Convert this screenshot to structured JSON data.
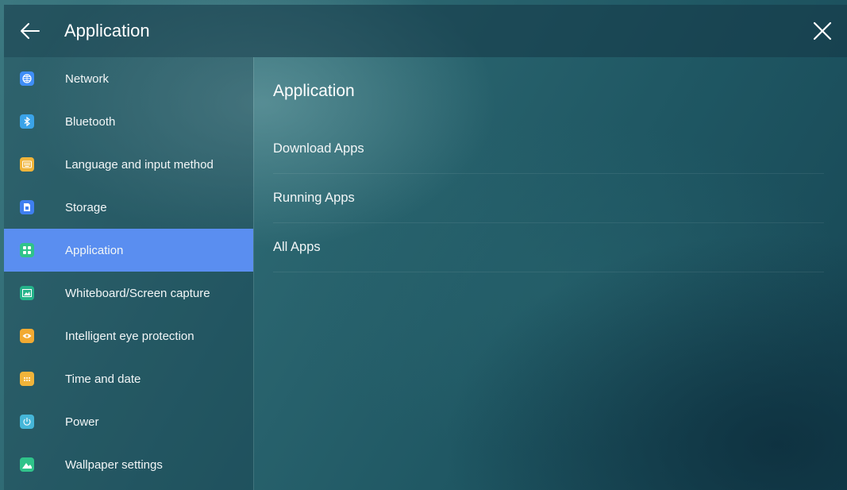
{
  "header": {
    "title": "Application"
  },
  "sidebar": {
    "items": [
      {
        "label": "Network",
        "icon": "globe-icon",
        "color": "#3f8ef7"
      },
      {
        "label": "Bluetooth",
        "icon": "bluetooth-icon",
        "color": "#3aa3e8"
      },
      {
        "label": "Language and input method",
        "icon": "keyboard-icon",
        "color": "#f0b43a"
      },
      {
        "label": "Storage",
        "icon": "storage-icon",
        "color": "#3f7ff0"
      },
      {
        "label": "Application",
        "icon": "apps-grid-icon",
        "color": "#2fc38a",
        "active": true
      },
      {
        "label": "Whiteboard/Screen capture",
        "icon": "screen-capture-icon",
        "color": "#24b38a"
      },
      {
        "label": "Intelligent eye protection",
        "icon": "eye-icon",
        "color": "#f2aa32"
      },
      {
        "label": "Time and date",
        "icon": "calendar-icon",
        "color": "#f0b43a"
      },
      {
        "label": "Power",
        "icon": "power-icon",
        "color": "#45b6d8"
      },
      {
        "label": "Wallpaper settings",
        "icon": "image-icon",
        "color": "#2fc38a"
      }
    ]
  },
  "main": {
    "title": "Application",
    "items": [
      {
        "label": "Download Apps"
      },
      {
        "label": "Running Apps"
      },
      {
        "label": "All Apps"
      }
    ]
  },
  "colors": {
    "accent": "#5a8ef0"
  }
}
